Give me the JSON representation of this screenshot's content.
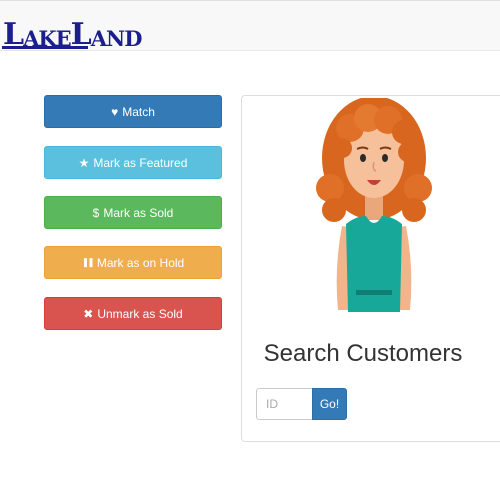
{
  "brand": {
    "logo_big_1": "L",
    "logo_small_1": "AKE",
    "logo_big_2": "L",
    "logo_small_2": "AND"
  },
  "actions": [
    {
      "icon": "♥",
      "icon_name": "heart-icon",
      "label": "Match"
    },
    {
      "icon": "★",
      "icon_name": "star-icon",
      "label": "Mark as Featured"
    },
    {
      "icon": "$",
      "icon_name": "dollar-icon",
      "label": "Mark as Sold"
    },
    {
      "icon": "❚❚",
      "icon_name": "pause-icon",
      "label": "Mark as on Hold"
    },
    {
      "icon": "✖",
      "icon_name": "x-icon",
      "label": "Unmark as Sold"
    }
  ],
  "search": {
    "title": "Search Customers",
    "placeholder": "ID",
    "button_label": "Go!"
  },
  "colors": {
    "primary": "#337ab7",
    "info": "#5bc0de",
    "success": "#5cb85c",
    "warning": "#f0ad4e",
    "danger": "#d9534f",
    "brand": "#1b1e8c"
  }
}
